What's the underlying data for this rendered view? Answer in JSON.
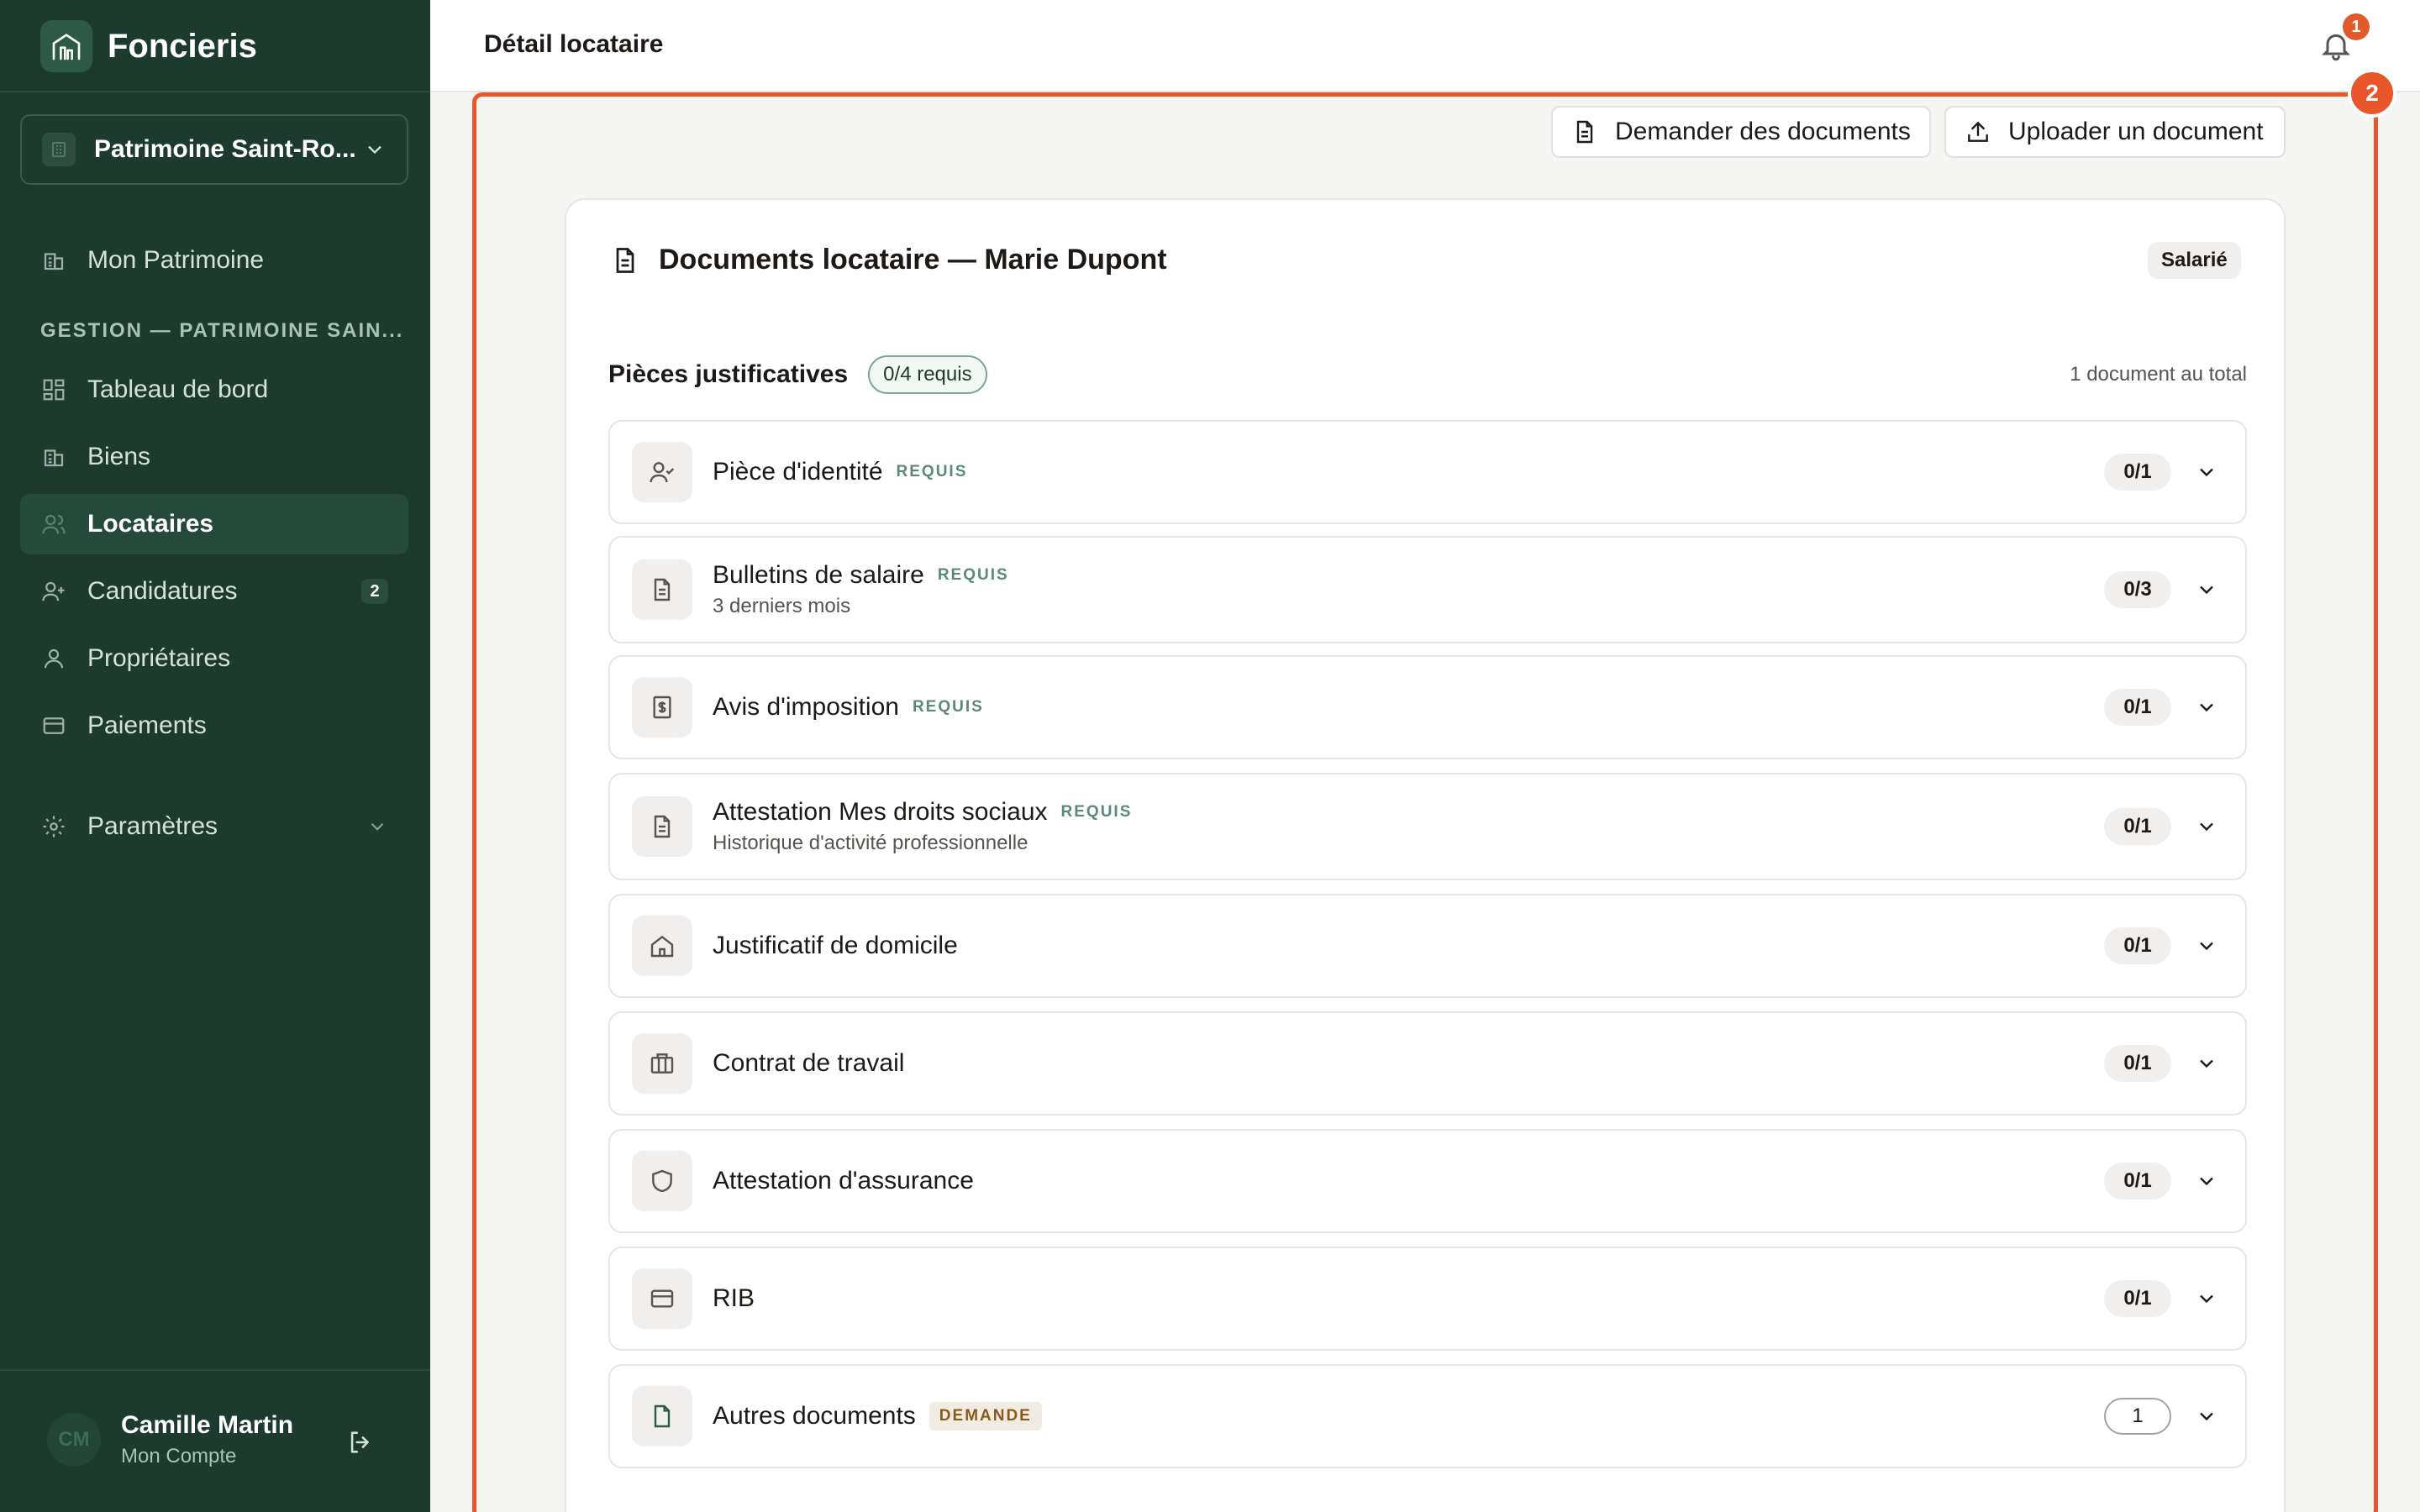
{
  "sidebar": {
    "brand": "Foncieris",
    "patrimoine": "Patrimoine Saint-Ro...",
    "mon_patrimoine": "Mon Patrimoine",
    "section_title": "GESTION — PATRIMOINE SAIN...",
    "items": [
      {
        "label": "Tableau de bord",
        "icon": "dashboard-icon"
      },
      {
        "label": "Biens",
        "icon": "building-icon"
      },
      {
        "label": "Locataires",
        "icon": "users-icon",
        "active": true
      },
      {
        "label": "Candidatures",
        "icon": "user-plus-icon",
        "badge": "2"
      },
      {
        "label": "Propriétaires",
        "icon": "user-icon"
      },
      {
        "label": "Paiements",
        "icon": "card-icon"
      }
    ],
    "settings": "Paramètres",
    "user": {
      "initials": "CM",
      "name": "Camille Martin",
      "sub": "Mon Compte"
    }
  },
  "topbar": {
    "title": "Détail locataire",
    "notifications": "1"
  },
  "frame_badge": "2",
  "actions": {
    "request": "Demander des documents",
    "upload": "Uploader un document"
  },
  "card": {
    "title": "Documents locataire — Marie Dupont",
    "status": "Salarié",
    "section": "Pièces justificatives",
    "required_count": "0/4 requis",
    "total": "1 document au total",
    "documents": [
      {
        "name": "Pièce d'identité",
        "tag": "REQUIS",
        "sub": "",
        "count": "0/1",
        "icon": "id-user-icon"
      },
      {
        "name": "Bulletins de salaire",
        "tag": "REQUIS",
        "sub": "3 derniers mois",
        "count": "0/3",
        "icon": "document-icon"
      },
      {
        "name": "Avis d'imposition",
        "tag": "REQUIS",
        "sub": "",
        "count": "0/1",
        "icon": "tax-receipt-icon"
      },
      {
        "name": "Attestation Mes droits sociaux",
        "tag": "REQUIS",
        "sub": "Historique d'activité professionnelle",
        "count": "0/1",
        "icon": "document-icon"
      },
      {
        "name": "Justificatif de domicile",
        "tag": "",
        "sub": "",
        "count": "0/1",
        "icon": "home-icon"
      },
      {
        "name": "Contrat de travail",
        "tag": "",
        "sub": "",
        "count": "0/1",
        "icon": "briefcase-icon"
      },
      {
        "name": "Attestation d'assurance",
        "tag": "",
        "sub": "",
        "count": "0/1",
        "icon": "shield-icon"
      },
      {
        "name": "RIB",
        "tag": "",
        "sub": "",
        "count": "0/1",
        "icon": "card-icon"
      },
      {
        "name": "Autres documents",
        "tag": "DEMANDE",
        "sub": "",
        "count": "1",
        "icon": "file-icon"
      }
    ]
  }
}
